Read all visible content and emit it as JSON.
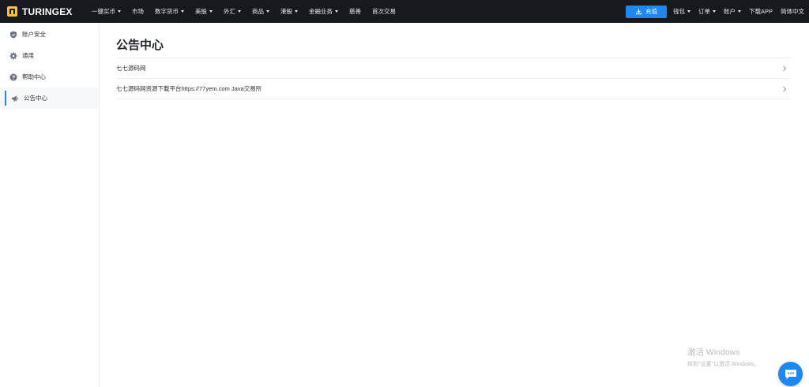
{
  "brand": {
    "name": "TURINGEX"
  },
  "nav": {
    "items": [
      {
        "label": "一键买币",
        "has_caret": true
      },
      {
        "label": "市场",
        "has_caret": false
      },
      {
        "label": "数字货币",
        "has_caret": true
      },
      {
        "label": "美股",
        "has_caret": true
      },
      {
        "label": "外汇",
        "has_caret": true
      },
      {
        "label": "商品",
        "has_caret": true
      },
      {
        "label": "港股",
        "has_caret": true
      },
      {
        "label": "金融业务",
        "has_caret": true
      },
      {
        "label": "慈善",
        "has_caret": false
      },
      {
        "label": "首次交易",
        "has_caret": false
      }
    ]
  },
  "header_right": {
    "recharge_label": "充值",
    "wallet_label": "钱包",
    "orders_label": "订单",
    "account_label": "账户",
    "download_label": "下载APP",
    "language_label": "简体中文"
  },
  "sidebar": {
    "items": [
      {
        "label": "账户安全",
        "icon": "shield-icon",
        "active": false
      },
      {
        "label": "通用",
        "icon": "gear-icon",
        "active": false
      },
      {
        "label": "帮助中心",
        "icon": "help-icon",
        "active": false
      },
      {
        "label": "公告中心",
        "icon": "megaphone-icon",
        "active": true
      }
    ]
  },
  "main": {
    "title": "公告中心",
    "announcements": [
      {
        "title": "七七源码网"
      },
      {
        "title": "七七源码网资源下载平台https://77yem.com Java交易所"
      }
    ]
  },
  "watermark": {
    "title": "激活 Windows",
    "subtitle": "转到\"设置\"以激活 Windows。"
  },
  "colors": {
    "topbar_bg": "#161a1e",
    "accent": "#1e88f0",
    "brand_logo": "#f2c14e"
  }
}
